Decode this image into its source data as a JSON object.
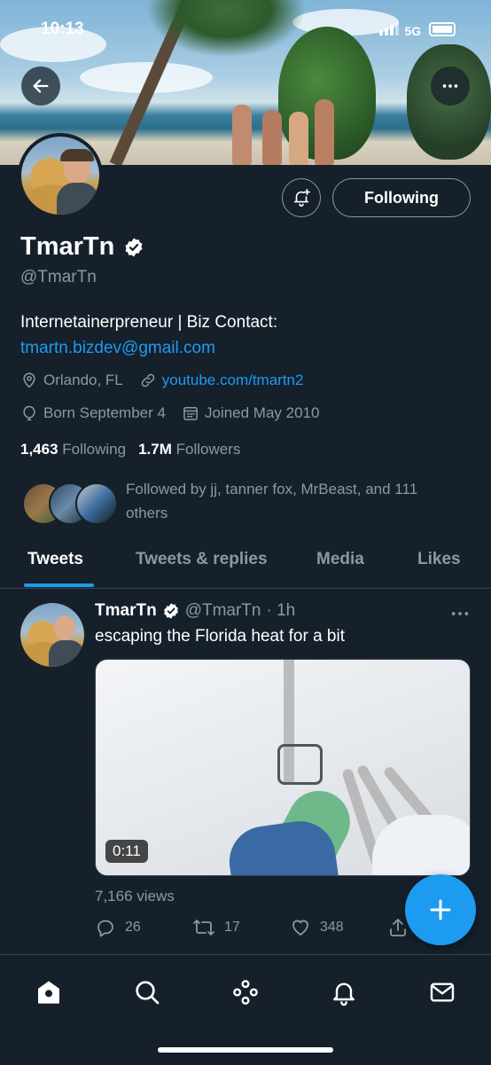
{
  "status_bar": {
    "time": "10:13",
    "network": "5G"
  },
  "profile": {
    "name": "TmarTn",
    "handle": "@TmarTn",
    "follow_button_label": "Following",
    "bio_line1": "Internetainerpreneur | Biz Contact:",
    "bio_email": "tmartn.bizdev@gmail.com",
    "location": "Orlando, FL",
    "website": "youtube.com/tmartn2",
    "birthday": "Born September 4",
    "joined": "Joined May 2010",
    "following_count": "1,463",
    "following_label": "Following",
    "followers_count": "1.7M",
    "followers_label": "Followers",
    "followed_by": "Followed by jj, tanner fox, MrBeast, and 111 others"
  },
  "tabs": [
    {
      "label": "Tweets",
      "active": true
    },
    {
      "label": "Tweets & replies",
      "active": false
    },
    {
      "label": "Media",
      "active": false
    },
    {
      "label": "Likes",
      "active": false
    }
  ],
  "tweet": {
    "author": "TmarTn",
    "handle": "@TmarTn",
    "time": "· 1h",
    "text": "escaping the Florida heat for a bit",
    "video_duration": "0:11",
    "views": "7,166 views",
    "replies": "26",
    "retweets": "17",
    "likes": "348"
  },
  "colors": {
    "background": "#15202b",
    "accent": "#1d9bf0",
    "muted": "#8b98a5",
    "divider": "#38444d"
  },
  "icons": [
    "back-arrow-icon",
    "more-icon",
    "notification-bell-icon",
    "verified-icon",
    "location-icon",
    "link-icon",
    "birthday-icon",
    "calendar-icon",
    "reply-icon",
    "retweet-icon",
    "like-icon",
    "share-icon",
    "compose-icon",
    "home-icon",
    "search-icon",
    "spaces-icon",
    "notifications-icon",
    "messages-icon"
  ]
}
